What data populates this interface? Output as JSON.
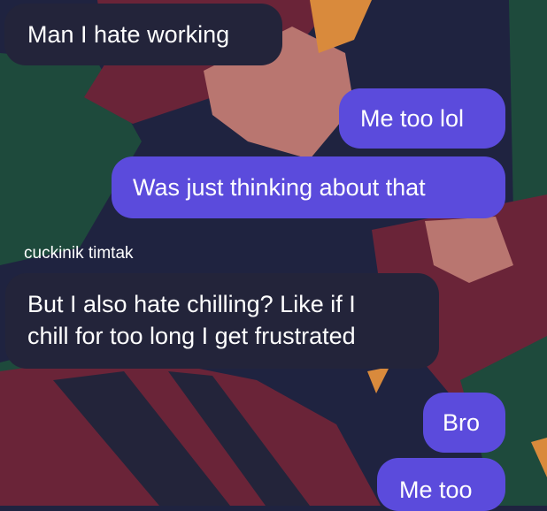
{
  "colors": {
    "incoming_bubble": "#23243a",
    "outgoing_bubble": "#5b4bdc",
    "text": "#ffffff",
    "wallpaper_dark": "#1f2340",
    "wallpaper_green": "#1e4a3c",
    "wallpaper_maroon": "#6a2438",
    "wallpaper_salmon": "#b97670",
    "wallpaper_orange": "#d98a3c"
  },
  "messages": [
    {
      "direction": "incoming",
      "text": "Man I hate working"
    },
    {
      "direction": "outgoing",
      "text": "Me too lol"
    },
    {
      "direction": "outgoing",
      "text": "Was just thinking about that"
    },
    {
      "direction": "incoming",
      "sender": "cuckinik timtak",
      "lines": [
        "But I also hate chilling? Like if I",
        "chill for too long I get frustrated"
      ]
    },
    {
      "direction": "outgoing",
      "text": "Bro"
    },
    {
      "direction": "outgoing",
      "text": "Me too"
    }
  ]
}
